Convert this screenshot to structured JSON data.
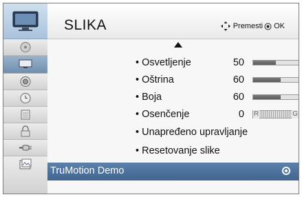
{
  "header": {
    "title": "SLIKA",
    "move_hint": "Premesti",
    "ok_hint": "OK"
  },
  "sidebar": {
    "items": [
      {
        "icon": "audio-disc-icon",
        "active": false
      },
      {
        "icon": "picture-tv-icon",
        "active": true
      },
      {
        "icon": "speaker-icon",
        "active": false
      },
      {
        "icon": "clock-icon",
        "active": false
      },
      {
        "icon": "options-grid-icon",
        "active": false
      },
      {
        "icon": "lock-icon",
        "active": false
      },
      {
        "icon": "input-plug-icon",
        "active": false
      },
      {
        "icon": "photo-media-icon",
        "active": false
      }
    ]
  },
  "menu": {
    "items": [
      {
        "label": "• Osvetljenje",
        "value": "50",
        "level": 0.5
      },
      {
        "label": "• Oštrina",
        "value": "60",
        "level": 0.6
      },
      {
        "label": "• Boja",
        "value": "60",
        "level": 0.6
      },
      {
        "label": "• Osenčenje",
        "value": "0",
        "tint_left": "R",
        "tint_right": "G"
      },
      {
        "label": "• Unapređeno upravljanje"
      },
      {
        "label": "• Resetovanje slike"
      }
    ],
    "selected": "TruMotion Demo"
  },
  "colors": {
    "highlight": "#4a6f9a",
    "active_sidebar": "#7e9cbc"
  }
}
